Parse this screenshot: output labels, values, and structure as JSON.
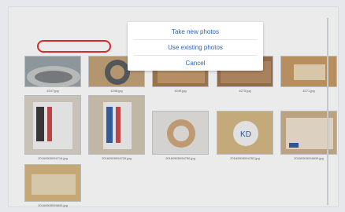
{
  "dialog": {
    "take_new": "Take new photos",
    "use_existing": "Use existing photos",
    "cancel": "Cancel"
  },
  "gallery": {
    "row1": [
      {
        "caption": "4247.jpg",
        "icon": "bearing-photo"
      },
      {
        "caption": "4248.jpg",
        "icon": "bearing-in-box-photo"
      },
      {
        "caption": "4249.jpg",
        "icon": "boxes-photo"
      },
      {
        "caption": "4270.jpg",
        "icon": "boxes-photo"
      },
      {
        "caption": "4271.jpg",
        "icon": "label-photo"
      }
    ],
    "row2": [
      {
        "caption": "20160505094716.jpg",
        "icon": "barcode-label-photo"
      },
      {
        "caption": "20160505094726.jpg",
        "icon": "barcode-label-photo"
      },
      {
        "caption": "20160505094750.jpg",
        "icon": "bearing-ring-photo"
      },
      {
        "caption": "20160505094762.jpg",
        "icon": "kd-label-photo"
      },
      {
        "caption": "20160505094839.jpg",
        "icon": "box-label-photo"
      }
    ],
    "row3": [
      {
        "caption": "20160505094843.jpg",
        "icon": "box-label-photo"
      }
    ]
  },
  "colors": {
    "dialog_text": "#2a62b9",
    "highlight": "#d22b2b"
  }
}
